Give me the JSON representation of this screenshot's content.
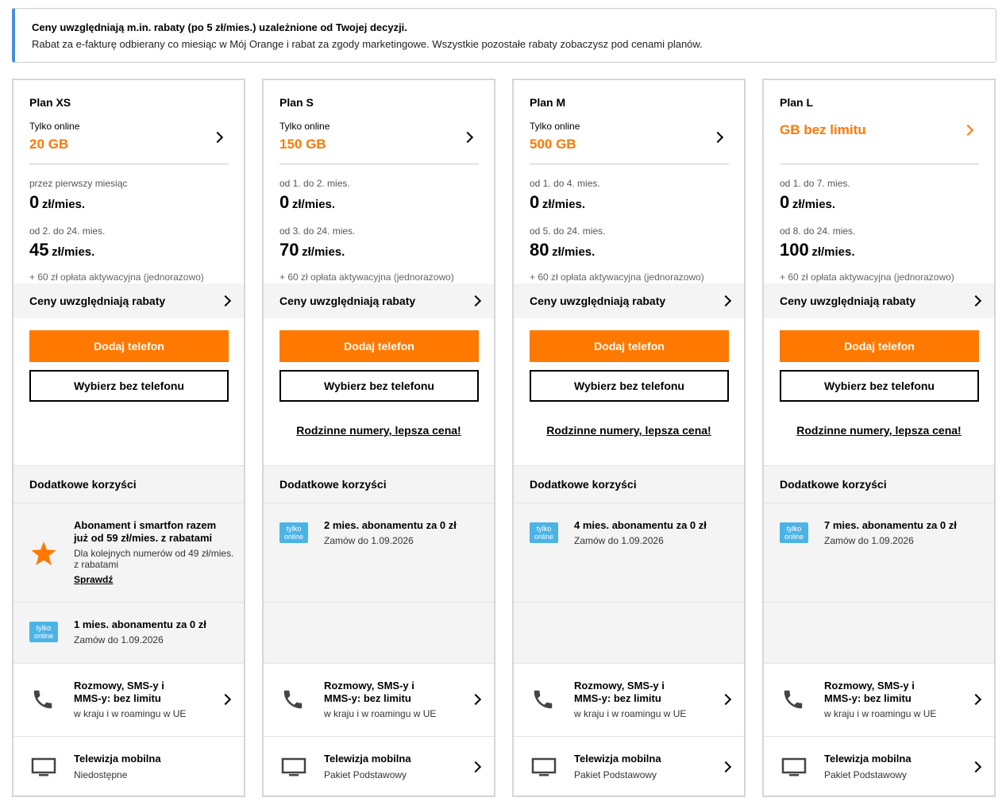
{
  "banner": {
    "title": "Ceny uwzględniają m.in. rabaty (po 5 zł/mies.) uzależnione od Twojej decyzji.",
    "text": "Rabat za e-fakturę odbierany co miesiąc w Mój Orange i rabat za zgody marketingowe. Wszystkie pozostałe rabaty zobaczysz pod cenami planów."
  },
  "colors": {
    "accent": "#ff7900",
    "badge": "#4bb4e6",
    "banner_border": "#4a8ed6"
  },
  "plans": [
    {
      "name": "Plan XS",
      "online_label": "Tylko online",
      "data": "20 GB",
      "period1": "przez pierwszy miesiąc",
      "price1": "0",
      "unit1": "zł/mies.",
      "period2": "od 2. do 24. mies.",
      "price2": "45",
      "unit2": "zł/mies.",
      "fee": "+ 60 zł opłata aktywacyjna (jednorazowo)",
      "discounts_label": "Ceny uwzględniają rabaty",
      "btn_phone": "Dodaj telefon",
      "btn_no_phone": "Wybierz bez telefonu",
      "family_link": "",
      "benefits_label": "Dodatkowe korzyści",
      "promo_star": {
        "title": "Abonament i smartfon razem już od 59 zł/mies. z rabatami",
        "sub": "Dla kolejnych numerów od 49 zł/mies. z rabatami",
        "link": "Sprawdź"
      },
      "promo_online": {
        "badge": "tylko online",
        "title": "1 mies. abonamentu za 0 zł",
        "sub": "Zamów do 1.09.2026"
      },
      "calls": {
        "title": "Rozmowy, SMS-y i MMS-y: bez limitu",
        "sub": "w kraju i w roamingu w UE"
      },
      "tv": {
        "title": "Telewizja mobilna",
        "sub": "Niedostępne"
      }
    },
    {
      "name": "Plan S",
      "online_label": "Tylko online",
      "data": "150 GB",
      "period1": "od 1. do 2. mies.",
      "price1": "0",
      "unit1": "zł/mies.",
      "period2": "od 3. do 24. mies.",
      "price2": "70",
      "unit2": "zł/mies.",
      "fee": "+ 60 zł opłata aktywacyjna (jednorazowo)",
      "discounts_label": "Ceny uwzględniają rabaty",
      "btn_phone": "Dodaj telefon",
      "btn_no_phone": "Wybierz bez telefonu",
      "family_link": "Rodzinne numery, lepsza cena!",
      "benefits_label": "Dodatkowe korzyści",
      "promo_online": {
        "badge": "tylko online",
        "title": "2 mies. abonamentu za 0 zł",
        "sub": "Zamów do 1.09.2026"
      },
      "calls": {
        "title": "Rozmowy, SMS-y i MMS-y: bez limitu",
        "sub": "w kraju i w roamingu w UE"
      },
      "tv": {
        "title": "Telewizja mobilna",
        "sub": "Pakiet Podstawowy"
      }
    },
    {
      "name": "Plan M",
      "online_label": "Tylko online",
      "data": "500 GB",
      "period1": "od 1. do 4. mies.",
      "price1": "0",
      "unit1": "zł/mies.",
      "period2": "od 5. do 24. mies.",
      "price2": "80",
      "unit2": "zł/mies.",
      "fee": "+ 60 zł opłata aktywacyjna (jednorazowo)",
      "discounts_label": "Ceny uwzględniają rabaty",
      "btn_phone": "Dodaj telefon",
      "btn_no_phone": "Wybierz bez telefonu",
      "family_link": "Rodzinne numery, lepsza cena!",
      "benefits_label": "Dodatkowe korzyści",
      "promo_online": {
        "badge": "tylko online",
        "title": "4 mies. abonamentu za 0 zł",
        "sub": "Zamów do 1.09.2026"
      },
      "calls": {
        "title": "Rozmowy, SMS-y i MMS-y: bez limitu",
        "sub": "w kraju i w roamingu w UE"
      },
      "tv": {
        "title": "Telewizja mobilna",
        "sub": "Pakiet Podstawowy"
      }
    },
    {
      "name": "Plan L",
      "online_label": "",
      "data": "GB bez limitu",
      "period1": "od 1. do 7. mies.",
      "price1": "0",
      "unit1": "zł/mies.",
      "period2": "od 8. do 24. mies.",
      "price2": "100",
      "unit2": "zł/mies.",
      "fee": "+ 60 zł opłata aktywacyjna (jednorazowo)",
      "discounts_label": "Ceny uwzględniają rabaty",
      "btn_phone": "Dodaj telefon",
      "btn_no_phone": "Wybierz bez telefonu",
      "family_link": "Rodzinne numery, lepsza cena!",
      "benefits_label": "Dodatkowe korzyści",
      "promo_online": {
        "badge": "tylko online",
        "title": "7 mies. abonamentu za 0 zł",
        "sub": "Zamów do 1.09.2026"
      },
      "calls": {
        "title": "Rozmowy, SMS-y i MMS-y: bez limitu",
        "sub": "w kraju i w roamingu w UE"
      },
      "tv": {
        "title": "Telewizja mobilna",
        "sub": "Pakiet Podstawowy"
      }
    }
  ]
}
